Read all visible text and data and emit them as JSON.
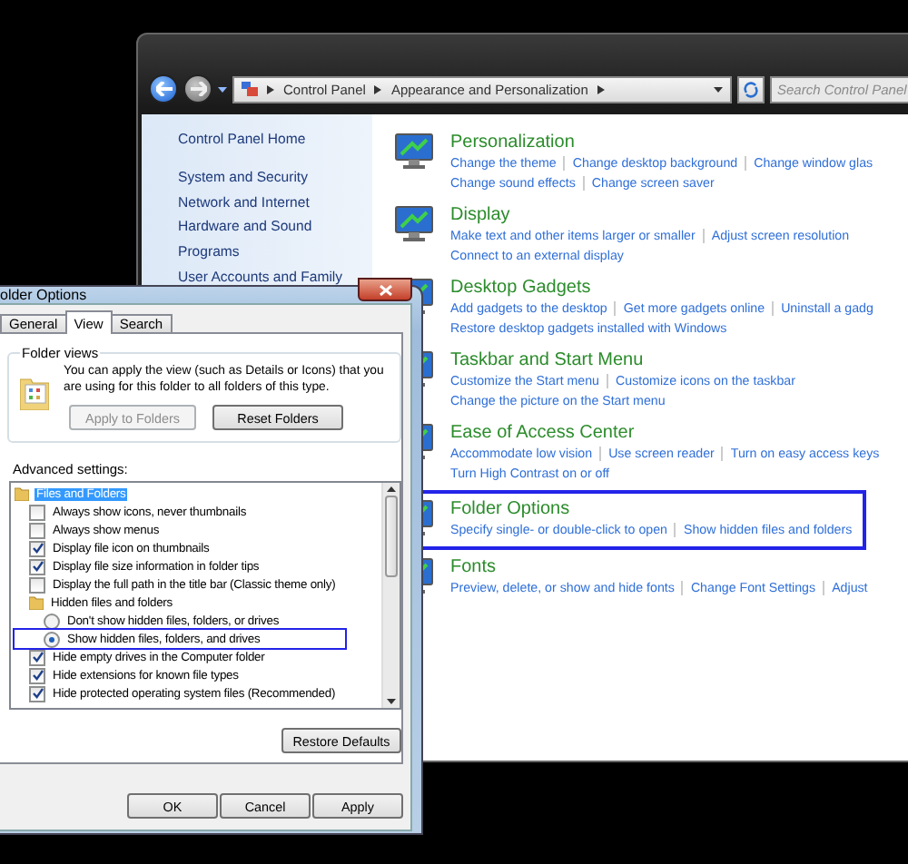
{
  "control_panel": {
    "breadcrumb": [
      "Control Panel",
      "Appearance and Personalization"
    ],
    "search": {
      "placeholder": "Search Control Panel"
    },
    "sidebar": {
      "items": [
        {
          "label": "Control Panel Home"
        },
        {
          "label": "System and Security"
        },
        {
          "label": "Network and Internet"
        },
        {
          "label": "Hardware and Sound"
        },
        {
          "label": "Programs"
        },
        {
          "label": "User Accounts and Family"
        }
      ]
    },
    "categories": [
      {
        "title": "Personalization",
        "highlighted": false,
        "link_rows": [
          [
            "Change the theme",
            "Change desktop background",
            "Change window glas"
          ],
          [
            "Change sound effects",
            "Change screen saver"
          ]
        ]
      },
      {
        "title": "Display",
        "highlighted": false,
        "link_rows": [
          [
            "Make text and other items larger or smaller",
            "Adjust screen resolution"
          ],
          [
            "Connect to an external display"
          ]
        ]
      },
      {
        "title": "Desktop Gadgets",
        "highlighted": false,
        "link_rows": [
          [
            "Add gadgets to the desktop",
            "Get more gadgets online",
            "Uninstall a gadg"
          ],
          [
            "Restore desktop gadgets installed with Windows"
          ]
        ]
      },
      {
        "title": "Taskbar and Start Menu",
        "highlighted": false,
        "link_rows": [
          [
            "Customize the Start menu",
            "Customize icons on the taskbar"
          ],
          [
            "Change the picture on the Start menu"
          ]
        ]
      },
      {
        "title": "Ease of Access Center",
        "highlighted": false,
        "link_rows": [
          [
            "Accommodate low vision",
            "Use screen reader",
            "Turn on easy access keys"
          ],
          [
            "Turn High Contrast on or off"
          ]
        ]
      },
      {
        "title": "Folder Options",
        "highlighted": true,
        "link_rows": [
          [
            "Specify single- or double-click to open",
            "Show hidden files and folders"
          ]
        ]
      },
      {
        "title": "Fonts",
        "highlighted": false,
        "link_rows": [
          [
            "Preview, delete, or show and hide fonts",
            "Change Font Settings",
            "Adjust"
          ]
        ]
      }
    ]
  },
  "dialog": {
    "title": "older Options",
    "tabs": [
      {
        "label": "General",
        "selected": false
      },
      {
        "label": "View",
        "selected": true
      },
      {
        "label": "Search",
        "selected": false
      }
    ],
    "folder_views": {
      "title": "Folder views",
      "text": "You can apply the view (such as Details or Icons) that you are using for this folder to all folders of this type.",
      "buttons": [
        {
          "label": "Apply to Folders",
          "disabled": true
        },
        {
          "label": "Reset Folders",
          "disabled": false
        }
      ]
    },
    "advanced_label": "Advanced settings:",
    "settings": [
      {
        "kind": "folder",
        "label": "Files and Folders",
        "selected": true,
        "children": [
          {
            "kind": "checkbox",
            "label": "Always show icons, never thumbnails",
            "checked": false
          },
          {
            "kind": "checkbox",
            "label": "Always show menus",
            "checked": false
          },
          {
            "kind": "checkbox",
            "label": "Display file icon on thumbnails",
            "checked": true
          },
          {
            "kind": "checkbox",
            "label": "Display file size information in folder tips",
            "checked": true
          },
          {
            "kind": "checkbox",
            "label": "Display the full path in the title bar (Classic theme only)",
            "checked": false
          },
          {
            "kind": "folder",
            "label": "Hidden files and folders",
            "selected": false,
            "children": [
              {
                "kind": "radio",
                "label": "Don't show hidden files, folders, or drives",
                "selected": false,
                "highlighted": false
              },
              {
                "kind": "radio",
                "label": "Show hidden files, folders, and drives",
                "selected": true,
                "highlighted": true
              }
            ]
          },
          {
            "kind": "checkbox",
            "label": "Hide empty drives in the Computer folder",
            "checked": true
          },
          {
            "kind": "checkbox",
            "label": "Hide extensions for known file types",
            "checked": true
          },
          {
            "kind": "checkbox",
            "label": "Hide protected operating system files (Recommended)",
            "checked": true
          }
        ]
      }
    ],
    "restore_button": "Restore Defaults",
    "buttons": [
      "OK",
      "Cancel",
      "Apply"
    ]
  }
}
